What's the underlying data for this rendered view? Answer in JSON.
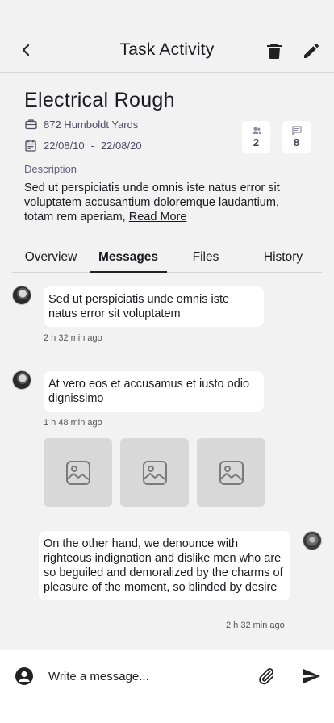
{
  "header": {
    "title": "Task Activity",
    "icons": {
      "back": "chevron-left-icon",
      "delete": "trash-icon",
      "edit": "pencil-icon"
    }
  },
  "task": {
    "title": "Electrical Rough",
    "address": "872 Humboldt Yards",
    "start_date": "22/08/10",
    "date_separator": "-",
    "end_date": "22/08/20",
    "people_count": "2",
    "message_count": "8",
    "description_label": "Description",
    "description": "Sed ut perspiciatis unde omnis iste natus error sit voluptatem accusantium doloremque laudantium, totam rem aperiam,",
    "read_more": "Read More"
  },
  "tabs": [
    {
      "label": "Overview",
      "active": false
    },
    {
      "label": "Messages",
      "active": true
    },
    {
      "label": "Files",
      "active": false
    },
    {
      "label": "History",
      "active": false
    }
  ],
  "messages": [
    {
      "text": "Sed ut perspiciatis unde omnis iste natus error sit voluptatem",
      "time": "2 h 32 min ago",
      "side": "left"
    },
    {
      "text": "At vero eos et accusamus et iusto odio dignissimo",
      "time": "1 h 48 min ago",
      "side": "left",
      "attachments": 3
    },
    {
      "text": "On the other hand, we denounce with righteous indignation and dislike men who are so beguiled and demoralized by the charms of pleasure of the moment, so blinded by desire",
      "time": "2 h 32 min ago",
      "side": "right"
    }
  ],
  "composer": {
    "placeholder": "Write a message..."
  },
  "colors": {
    "background": "#f2f2f2",
    "card": "#ffffff",
    "placeholder_image": "#d8d8d8",
    "text": "#1b1b1f"
  }
}
